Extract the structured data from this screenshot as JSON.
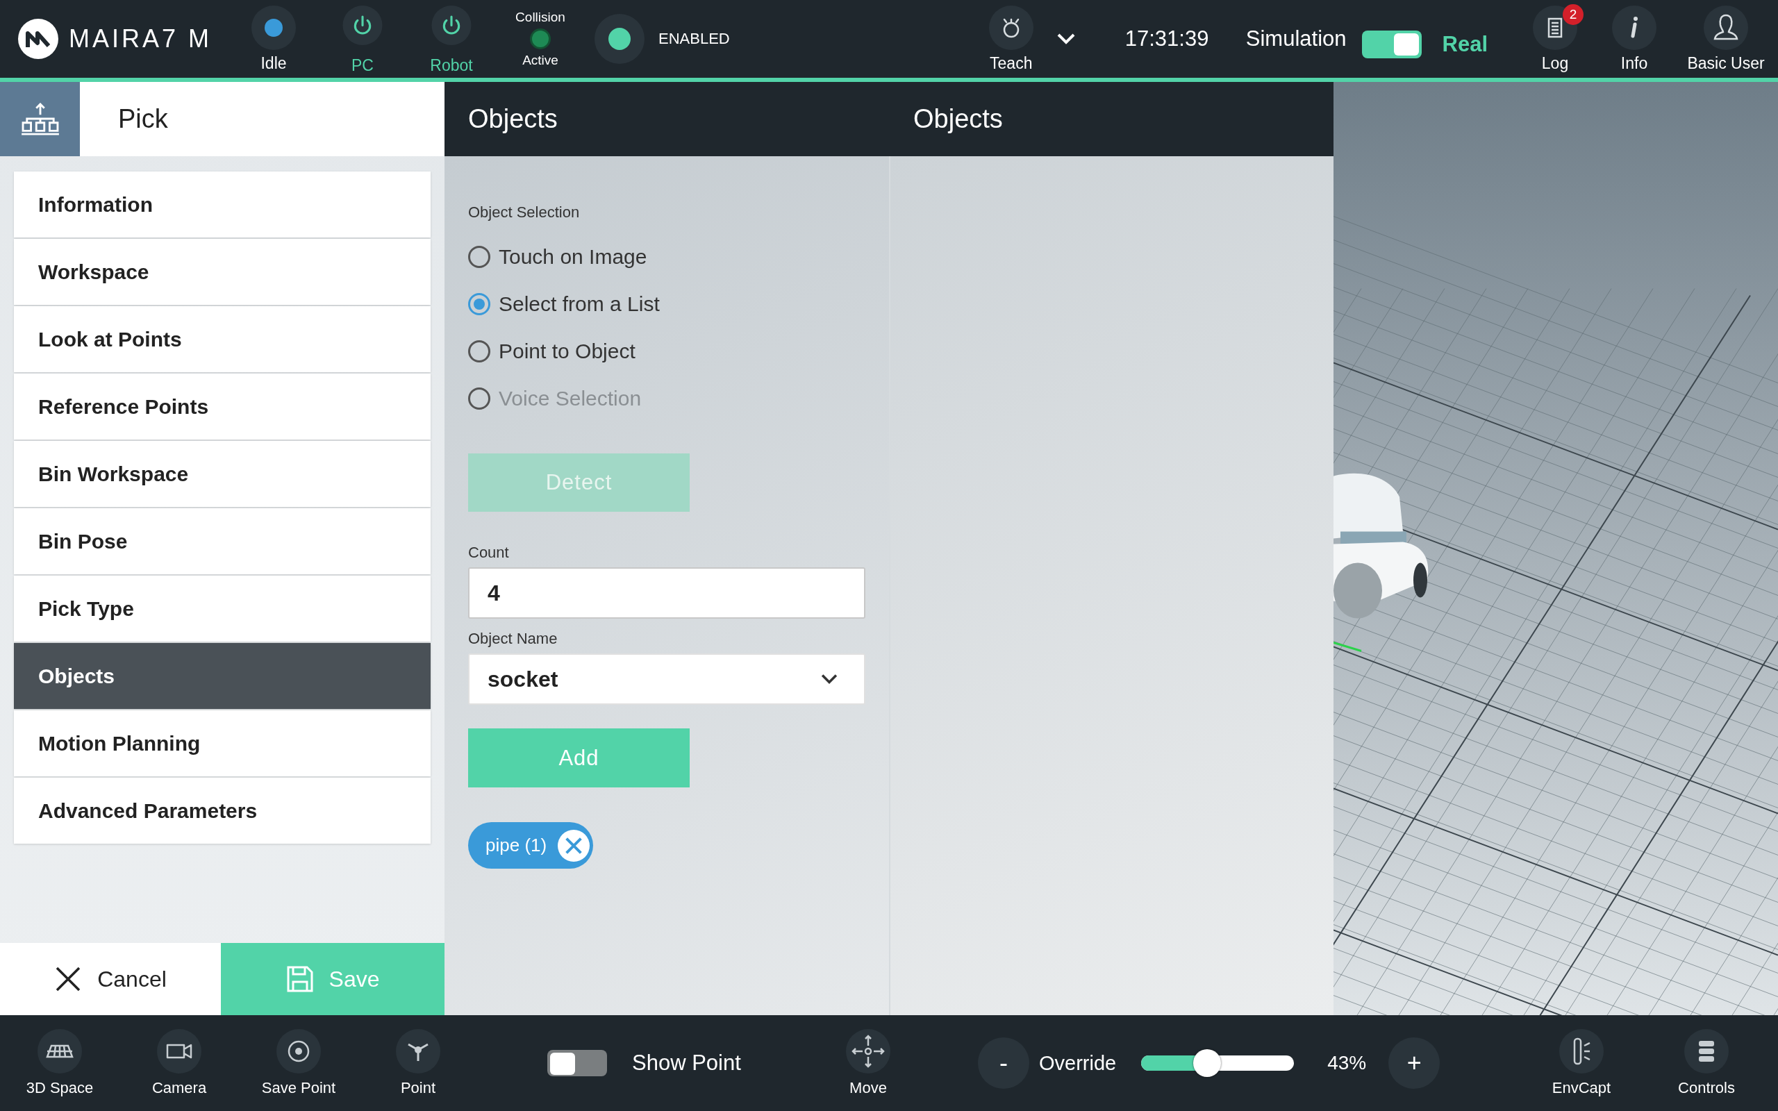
{
  "top_bar": {
    "logo": "MAIRA7 M",
    "status": [
      {
        "kind": "dot",
        "label": "Idle",
        "color": "#3a9ad9",
        "active": false
      },
      {
        "kind": "power",
        "label": "PC",
        "color": "#52d3a8",
        "active": true
      },
      {
        "kind": "power",
        "label": "Robot",
        "color": "#52d3a8",
        "active": true
      }
    ],
    "collision": {
      "title": "Collision",
      "label": "Active",
      "color": "#1e8a55"
    },
    "enable": {
      "label": "ENABLED",
      "color": "#52d3a8"
    },
    "mode": {
      "label": "Teach"
    },
    "time": "17:31:39",
    "sim_toggle": {
      "left_label": "Simulation",
      "right_label": "Real",
      "on": true
    },
    "buttons": [
      {
        "kind": "log",
        "label": "Log",
        "badge": "2"
      },
      {
        "kind": "info",
        "label": "Info"
      },
      {
        "kind": "user",
        "label": "Basic User"
      }
    ]
  },
  "step": {
    "title": "Pick"
  },
  "sidebar": {
    "items": [
      {
        "label": "Information",
        "selected": false
      },
      {
        "label": "Workspace",
        "selected": false
      },
      {
        "label": "Look at Points",
        "selected": false
      },
      {
        "label": "Reference Points",
        "selected": false
      },
      {
        "label": "Bin Workspace",
        "selected": false
      },
      {
        "label": "Bin Pose",
        "selected": false
      },
      {
        "label": "Pick Type",
        "selected": false
      },
      {
        "label": "Objects",
        "selected": true
      },
      {
        "label": "Motion Planning",
        "selected": false
      },
      {
        "label": "Advanced Parameters",
        "selected": false
      }
    ]
  },
  "footer": {
    "cancel": "Cancel",
    "save": "Save"
  },
  "panels": [
    {
      "title": "Objects"
    },
    {
      "title": "Objects"
    }
  ],
  "form": {
    "section": "Object Selection",
    "options": [
      {
        "label": "Touch on Image",
        "selected": false,
        "disabled": false
      },
      {
        "label": "Select from a List",
        "selected": true,
        "disabled": false
      },
      {
        "label": "Point to Object",
        "selected": false,
        "disabled": false
      },
      {
        "label": "Voice Selection",
        "selected": false,
        "disabled": true
      }
    ],
    "detect": {
      "label": "Detect",
      "disabled": true
    },
    "count": {
      "label": "Count",
      "value": "4"
    },
    "object_name": {
      "label": "Object Name",
      "value": "socket"
    },
    "add": "Add",
    "chips": [
      {
        "label": "pipe (1)"
      }
    ]
  },
  "bottom_bar": {
    "tools": [
      {
        "kind": "space",
        "label": "3D Space"
      },
      {
        "kind": "camera",
        "label": "Camera"
      },
      {
        "kind": "savepoint",
        "label": "Save Point"
      },
      {
        "kind": "point",
        "label": "Point"
      }
    ],
    "show_point": {
      "label": "Show Point",
      "on": false
    },
    "move": {
      "label": "Move"
    },
    "override": {
      "minus": "-",
      "label": "Override",
      "level": 0.43,
      "reading": "43%",
      "plus": "+"
    },
    "right_tools": [
      {
        "kind": "envcapt",
        "label": "EnvCapt"
      },
      {
        "kind": "controls",
        "label": "Controls"
      }
    ]
  }
}
